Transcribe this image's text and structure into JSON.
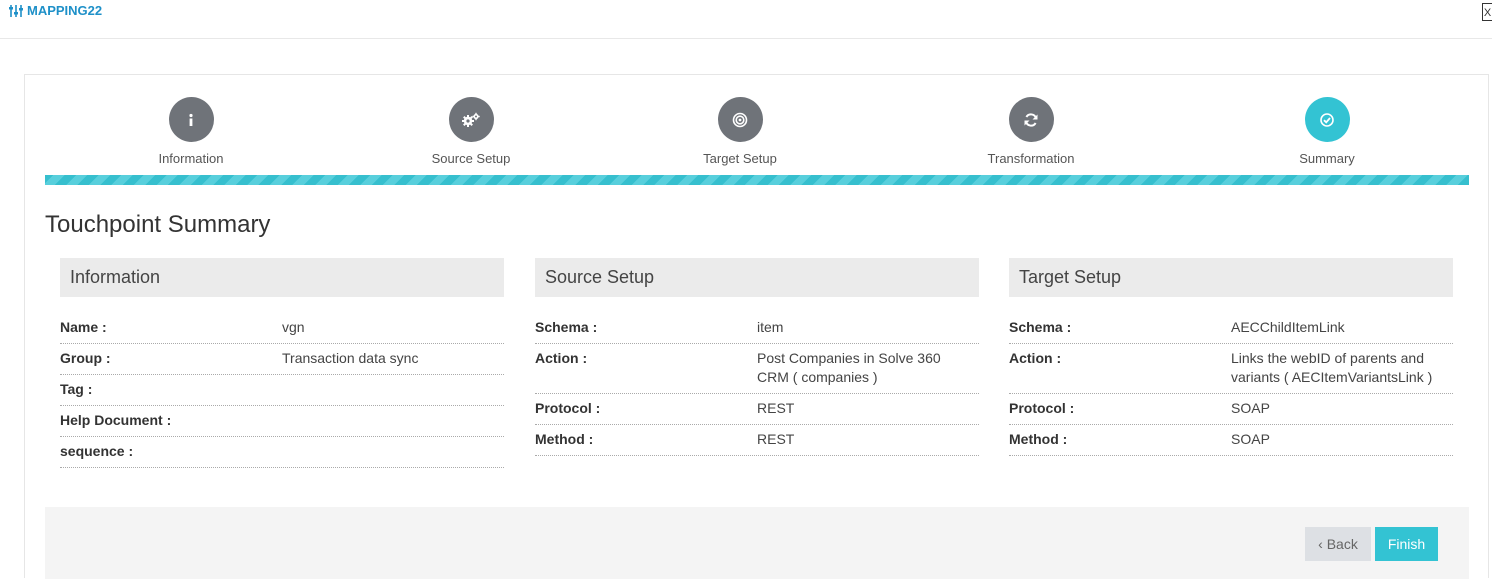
{
  "app": {
    "title": "MAPPING22",
    "close_label": "X"
  },
  "steps": [
    {
      "label": "Information",
      "icon": "info-icon",
      "active": false
    },
    {
      "label": "Source Setup",
      "icon": "gears-icon",
      "active": false
    },
    {
      "label": "Target Setup",
      "icon": "target-icon",
      "active": false
    },
    {
      "label": "Transformation",
      "icon": "refresh-icon",
      "active": false
    },
    {
      "label": "Summary",
      "icon": "check-circle-icon",
      "active": true
    }
  ],
  "colors": {
    "accent": "#33c3d3",
    "step_inactive": "#6f7379",
    "title_blue": "#1e90c8"
  },
  "page_title": "Touchpoint Summary",
  "cards": {
    "information": {
      "title": "Information",
      "rows": [
        {
          "key": "Name :",
          "value": "vgn"
        },
        {
          "key": "Group :",
          "value": "Transaction data sync"
        },
        {
          "key": "Tag :",
          "value": ""
        },
        {
          "key": "Help Document :",
          "value": ""
        },
        {
          "key": "sequence :",
          "value": ""
        }
      ]
    },
    "source": {
      "title": "Source Setup",
      "rows": [
        {
          "key": "Schema :",
          "value": "item"
        },
        {
          "key": "Action :",
          "value": "Post Companies in Solve 360 CRM ( companies )"
        },
        {
          "key": "Protocol :",
          "value": "REST"
        },
        {
          "key": "Method :",
          "value": "REST"
        }
      ]
    },
    "target": {
      "title": "Target Setup",
      "rows": [
        {
          "key": "Schema :",
          "value": "AECChildItemLink"
        },
        {
          "key": "Action :",
          "value": "Links the webID of parents and variants ( AECItemVariantsLink )"
        },
        {
          "key": "Protocol :",
          "value": "SOAP"
        },
        {
          "key": "Method :",
          "value": "SOAP"
        }
      ]
    }
  },
  "footer": {
    "back_label": "‹ Back",
    "finish_label": "Finish"
  }
}
